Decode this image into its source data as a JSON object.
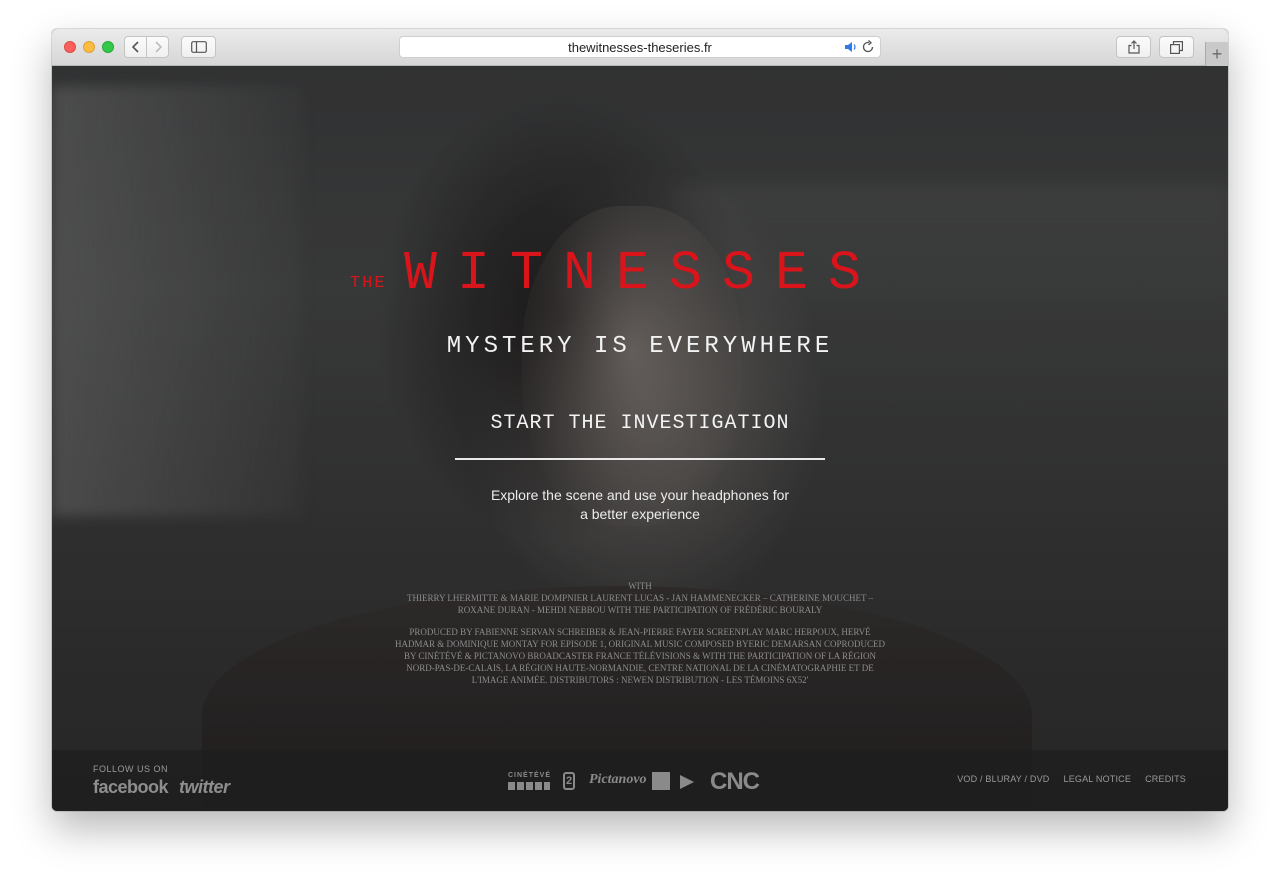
{
  "browser": {
    "url": "thewitnesses-theseries.fr"
  },
  "hero": {
    "title_prefix": "THE",
    "title": "WITNESSES",
    "tagline": "MYSTERY IS EVERYWHERE",
    "cta": "START THE INVESTIGATION",
    "intro": "Explore the scene and use your headphones for a better experience"
  },
  "credits": {
    "with_label": "WITH",
    "cast": "THIERRY LHERMITTE & MARIE DOMPNIER LAURENT LUCAS - JAN HAMMENECKER – CATHERINE MOUCHET – ROXANE DURAN - MEHDI NEBBOU WITH THE PARTICIPATION OF FRÉDÉRIC BOURALY",
    "production": "PRODUCED BY FABIENNE SERVAN SCHREIBER & JEAN-PIERRE FAYER SCREENPLAY MARC HERPOUX, HERVÉ HADMAR & DOMINIQUE MONTAY FOR EPISODE 1, ORIGINAL MUSIC COMPOSED BYERIC DEMARSAN COPRODUCED BY CINÉTÉVÉ & PICTANOVO BROADCASTER FRANCE TÉLÉVISIONS & WITH THE PARTICIPATION OF LA RÉGION NORD-PAS-DE-CALAIS, LA RÉGION HAUTE-NORMANDIE, CENTRE NATIONAL DE LA CINÉMATOGRAPHIE ET DE L'IMAGE ANIMÉE. DISTRIBUTORS : NEWEN DISTRIBUTION - LES TÉMOINS 6X52'"
  },
  "footer": {
    "follow_label": "FOLLOW US ON",
    "social": [
      "facebook",
      "twitter"
    ],
    "partner_logos": [
      "CINÉTÉVÉ",
      "2",
      "Pictanovo",
      "CNC"
    ],
    "links": [
      "VOD / BLURAY / DVD",
      "LEGAL NOTICE",
      "CREDITS"
    ]
  },
  "colors": {
    "title_red": "#d9141b",
    "footer_bg": "#1e1e1e"
  },
  "icons": [
    "back-icon",
    "forward-icon",
    "sidebar-icon",
    "speaker-icon",
    "reload-icon",
    "share-icon",
    "tabs-icon",
    "new-tab-icon"
  ]
}
